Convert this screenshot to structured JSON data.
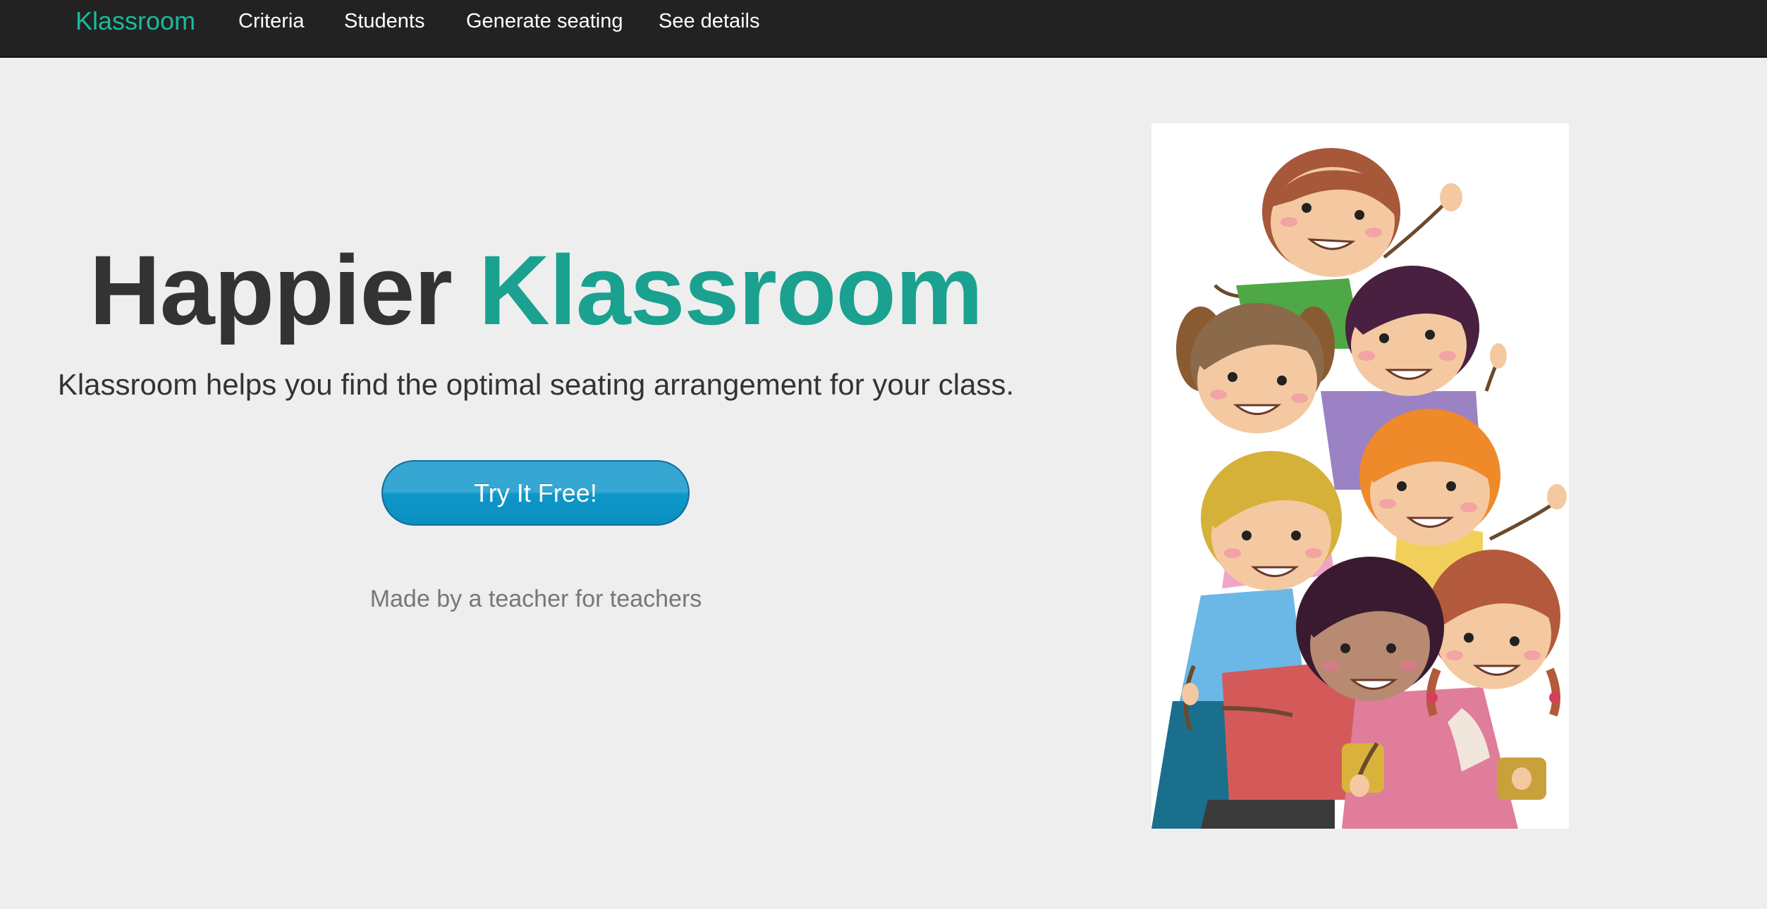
{
  "navbar": {
    "brand": "Klassroom",
    "links": [
      "Criteria",
      "Students",
      "Generate seating",
      "See details"
    ]
  },
  "hero": {
    "title_part1": "Happier",
    "title_part2": "Klassroom",
    "subtitle": "Klassroom helps you find the optimal seating arrangement for your class.",
    "cta_label": "Try It Free!",
    "tagline": "Made by a teacher for teachers"
  },
  "colors": {
    "accent": "#18bc9c",
    "navbar_bg": "#222222",
    "page_bg": "#eeeeee",
    "button_blue": "#0e97c9"
  },
  "icons": [
    "children-illustration"
  ]
}
